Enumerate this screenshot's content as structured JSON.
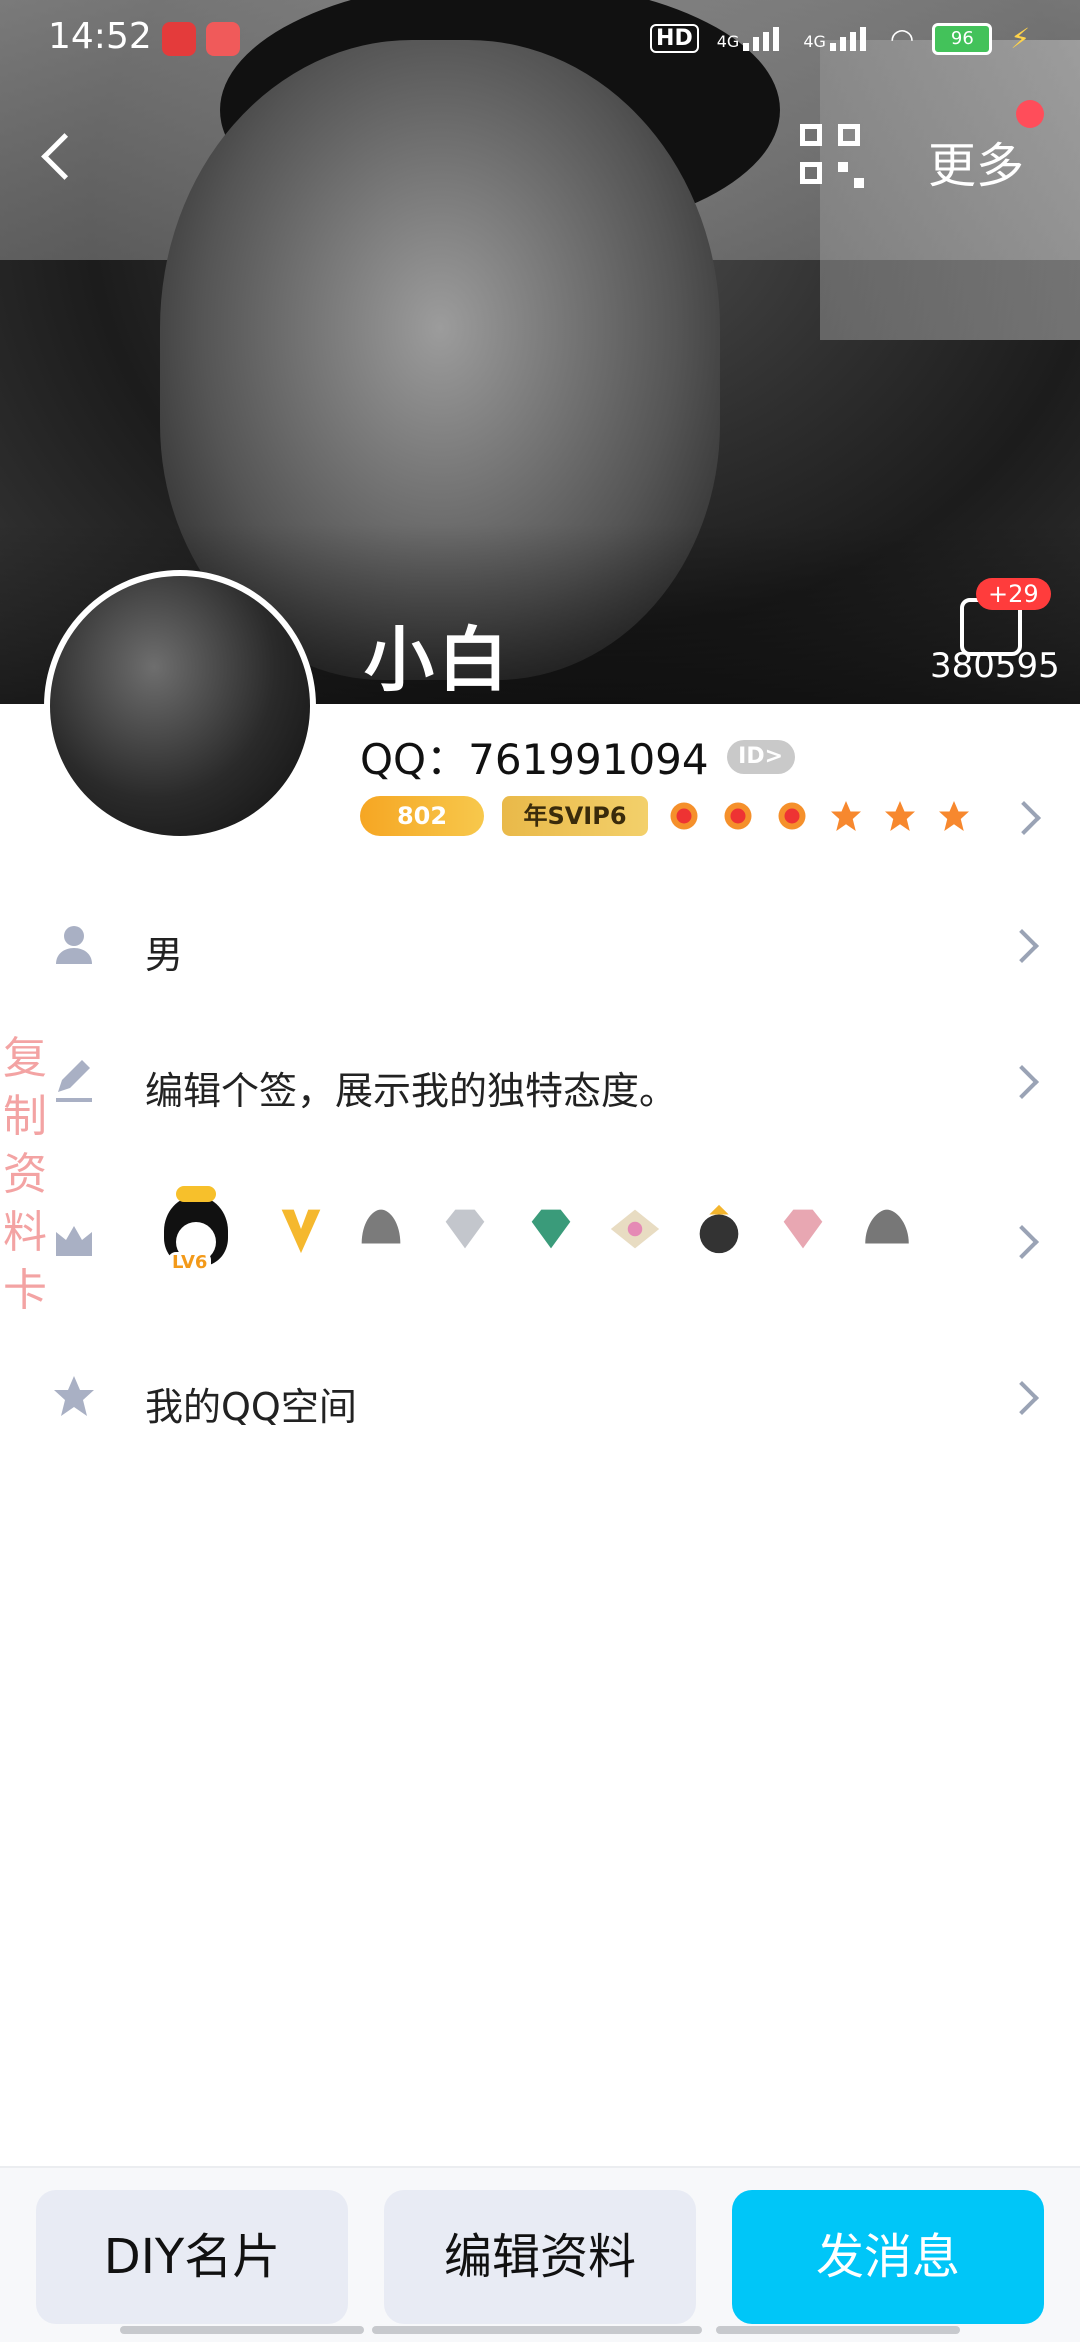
{
  "status_bar": {
    "time": "14:52",
    "battery": "96",
    "net1": "4G",
    "net2": "4G",
    "hd": "HD"
  },
  "header": {
    "more_label": "更多"
  },
  "profile": {
    "name": "小白",
    "qq_label": "QQ：",
    "qq_number": "761991094",
    "id_tag": "ID>",
    "like_badge": "+29",
    "like_count": "380595",
    "coin_level": "802",
    "svip_label": "年SVIP6"
  },
  "rows": {
    "gender": "男",
    "signature": "编辑个签，展示我的独特态度。",
    "qzone": "我的QQ空间"
  },
  "side_tab": {
    "label": "复制资料卡"
  },
  "medals": {
    "penguin_level": "LV6"
  },
  "bottom_bar": {
    "diy_label": "DIY名片",
    "edit_label": "编辑资料",
    "message_label": "发消息"
  }
}
